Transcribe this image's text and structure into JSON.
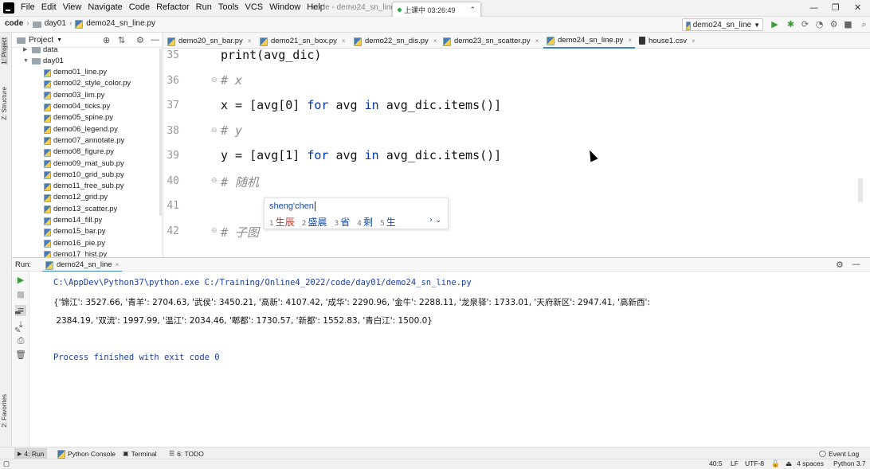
{
  "menu": {
    "items": [
      "File",
      "Edit",
      "View",
      "Navigate",
      "Code",
      "Refactor",
      "Run",
      "Tools",
      "VCS",
      "Window",
      "Help"
    ],
    "window_title": "code - demo24_sn_line.",
    "class_status": "上课中 03:26:49"
  },
  "nav": {
    "project": "code",
    "folder": "day01",
    "file": "demo24_sn_line.py",
    "run_config": "demo24_sn_line",
    "start_button": "开始"
  },
  "left_strip": {
    "project_tab": "1: Project",
    "structure_tab": "Z: Structure",
    "favorites_tab": "2: Favorites"
  },
  "project": {
    "title": "Project",
    "tree": [
      {
        "label": "data",
        "type": "folder",
        "depth": 1,
        "expanded": false
      },
      {
        "label": "day01",
        "type": "folder",
        "depth": 1,
        "expanded": true
      },
      {
        "label": "demo01_line.py",
        "type": "py",
        "depth": 2
      },
      {
        "label": "demo02_style_color.py",
        "type": "py",
        "depth": 2
      },
      {
        "label": "demo03_lim.py",
        "type": "py",
        "depth": 2
      },
      {
        "label": "demo04_ticks.py",
        "type": "py",
        "depth": 2
      },
      {
        "label": "demo05_spine.py",
        "type": "py",
        "depth": 2
      },
      {
        "label": "demo06_legend.py",
        "type": "py",
        "depth": 2
      },
      {
        "label": "demo07_annotate.py",
        "type": "py",
        "depth": 2
      },
      {
        "label": "demo08_figure.py",
        "type": "py",
        "depth": 2
      },
      {
        "label": "demo09_mat_sub.py",
        "type": "py",
        "depth": 2
      },
      {
        "label": "demo10_grid_sub.py",
        "type": "py",
        "depth": 2
      },
      {
        "label": "demo11_free_sub.py",
        "type": "py",
        "depth": 2
      },
      {
        "label": "demo12_grid.py",
        "type": "py",
        "depth": 2
      },
      {
        "label": "demo13_scatter.py",
        "type": "py",
        "depth": 2
      },
      {
        "label": "demo14_fill.py",
        "type": "py",
        "depth": 2
      },
      {
        "label": "demo15_bar.py",
        "type": "py",
        "depth": 2
      },
      {
        "label": "demo16_pie.py",
        "type": "py",
        "depth": 2
      },
      {
        "label": "demo17_hist.py",
        "type": "py",
        "depth": 2
      }
    ]
  },
  "tabs": [
    {
      "label": "demo20_sn_bar.py",
      "active": false,
      "type": "py"
    },
    {
      "label": "demo21_sn_box.py",
      "active": false,
      "type": "py"
    },
    {
      "label": "demo22_sn_dis.py",
      "active": false,
      "type": "py"
    },
    {
      "label": "demo23_sn_scatter.py",
      "active": false,
      "type": "py"
    },
    {
      "label": "demo24_sn_line.py",
      "active": true,
      "type": "py"
    },
    {
      "label": "house1.csv",
      "active": false,
      "type": "csv"
    }
  ],
  "code": {
    "lines": [
      {
        "num": "35",
        "text": "print(avg_dic)",
        "kind": "code"
      },
      {
        "num": "36",
        "text": "# x",
        "kind": "comment"
      },
      {
        "num": "37",
        "text": "x = [avg[0] for avg in avg_dic.items()]",
        "kind": "code"
      },
      {
        "num": "38",
        "text": "# y",
        "kind": "comment"
      },
      {
        "num": "39",
        "text": "y = [avg[1] for avg in avg_dic.items()]",
        "kind": "code"
      },
      {
        "num": "40",
        "text": "# 随机",
        "kind": "comment"
      },
      {
        "num": "41",
        "text": "",
        "kind": "code"
      },
      {
        "num": "42",
        "text": "# 子图",
        "kind": "comment"
      }
    ]
  },
  "ime": {
    "input": "sheng'chen",
    "candidates": [
      {
        "n": "1",
        "text": "生辰"
      },
      {
        "n": "2",
        "text": "盛晨"
      },
      {
        "n": "3",
        "text": "省"
      },
      {
        "n": "4",
        "text": "剩"
      },
      {
        "n": "5",
        "text": "生"
      }
    ],
    "nav": "›  ⌄"
  },
  "run": {
    "label": "Run:",
    "tab": "demo24_sn_line",
    "output": [
      "C:\\AppDev\\Python37\\python.exe C:/Training/Online4_2022/code/day01/demo24_sn_line.py",
      "{'锦江': 3527.66, '青羊': 2704.63, '武侯': 3450.21, '高新': 4107.42, '成华': 2290.96, '金牛': 2288.11, '龙泉驿': 1733.01, '天府新区': 2947.41, '高新西':",
      " 2384.19, '双流': 1997.99, '温江': 2034.46, '郫都': 1730.57, '新都': 1552.83, '青白江': 1500.0}",
      "Process finished with exit code 0"
    ]
  },
  "tool_windows": {
    "run": "4: Run",
    "python_console": "Python Console",
    "terminal": "Terminal",
    "todo": "6: TODO",
    "event_log": "Event Log"
  },
  "status": {
    "position": "40:5",
    "line_sep": "LF",
    "encoding": "UTF-8",
    "indent": "4 spaces",
    "interpreter": "Python 3.7"
  }
}
